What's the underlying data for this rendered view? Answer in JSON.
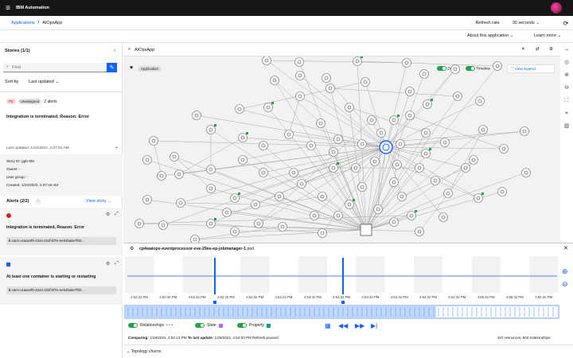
{
  "header": {
    "app_title": "IBM Automation"
  },
  "breadcrumb": {
    "link": "Applications",
    "separator": "/",
    "current": "AIOpsApp"
  },
  "refresh": {
    "label": "Refresh rate",
    "value": "30 seconds"
  },
  "subbar": {
    "about": "About this application",
    "learn": "Learn more"
  },
  "stories": {
    "title": "Stories (1/1)",
    "search_placeholder": "Find",
    "sort_label": "Sort by",
    "sort_value": "Last updated",
    "card": {
      "priority": "P5",
      "status": "Unassigned",
      "alerts": "2 alerts",
      "title": "Integration is terminated, Reason: Error",
      "last_updated": "Last updated: 1/23/2022, 2:37:51 AM",
      "story_id": "Story ID: gpb-5M",
      "owner": "Owner: -",
      "user_group": "User group: -",
      "created": "Created: 1/23/2022, 2:37:19 AM"
    },
    "alerts_title": "Alerts (2/2)",
    "view_story": "View story",
    "alert_list": [
      {
        "title": "Integration is terminated, Reason: Error",
        "resource": "cann-ucaav4f6-4344-434f-bf7e-eeb45a6e7fb0..."
      },
      {
        "title": "At least one container is starting or restarting",
        "resource": "cann-ucaav4f6-4344-434f-bf7e-eeb45a6e7fb0..."
      }
    ]
  },
  "graph": {
    "search_value": "AIOpsApp",
    "app_badge": "Application",
    "toggle_delta": "Delta",
    "toggle_timeline": "Timeline",
    "view_legend": "View legend"
  },
  "panel": {
    "title": "cp4waiops-eventprocessor-eve-29ee-ep-jobmanager-1",
    "type": "pod",
    "time_labels": [
      "4:52:32 PM",
      "4:52:32 PM",
      "4:52:32 PM",
      "4:52:32 PM",
      "4:52:32 PM",
      "4:52:32 PM",
      "4:53:32 PM",
      "4:53:32 PM",
      "4:53:32 PM",
      "4:54:32 PM",
      "4:54:32 PM",
      "4:54:32 PM",
      "4:55:32 PM",
      "4:55:32 PM",
      "4:55:32 PM"
    ],
    "toggle_relationships": "Relationships",
    "toggle_state": "State",
    "toggle_property": "Property",
    "comparing_label": "Comparing:",
    "comparing_value": "1/28/2022, 4:52:13 PM",
    "to_label": "To last update:",
    "to_value": "1/28/2022, 4:54:03 PM Refresh paused",
    "summary": "347 resources, 904 relationships",
    "churn": "Topology churns"
  },
  "colors": {
    "accent": "#0f62fe",
    "topbar": "#161616",
    "toggle_on": "#24a148",
    "alert_red": "#da1e28",
    "state": "#a56eff",
    "property": "#009d9a"
  }
}
